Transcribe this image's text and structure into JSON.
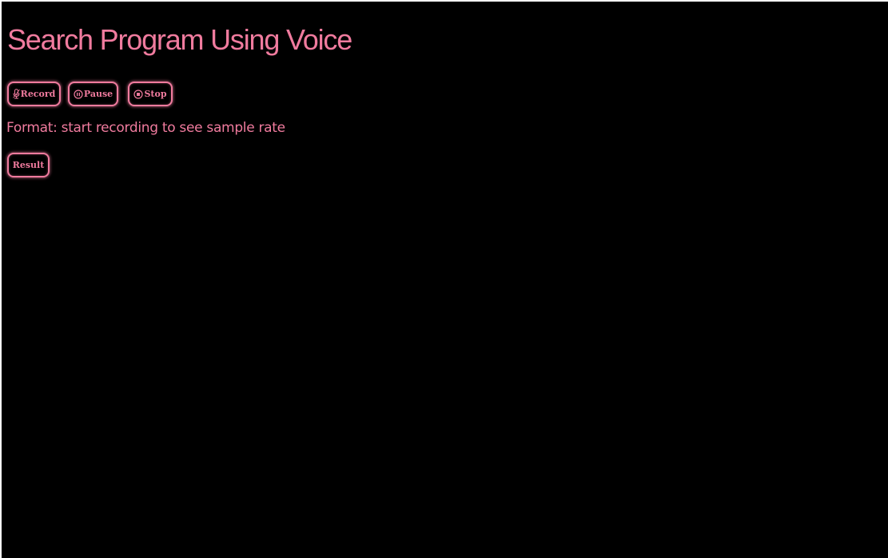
{
  "header": {
    "title": "Search Program Using Voice"
  },
  "controls": {
    "record_label": "Record",
    "record_icon": "microphone-icon",
    "pause_label": "Pause",
    "pause_icon": "pause-circle-icon",
    "stop_label": "Stop",
    "stop_icon": "stop-circle-icon"
  },
  "status": {
    "format_text": "Format: start recording to see sample rate"
  },
  "result": {
    "label": "Result"
  },
  "colors": {
    "background": "#000000",
    "accent": "#f07b9e"
  }
}
